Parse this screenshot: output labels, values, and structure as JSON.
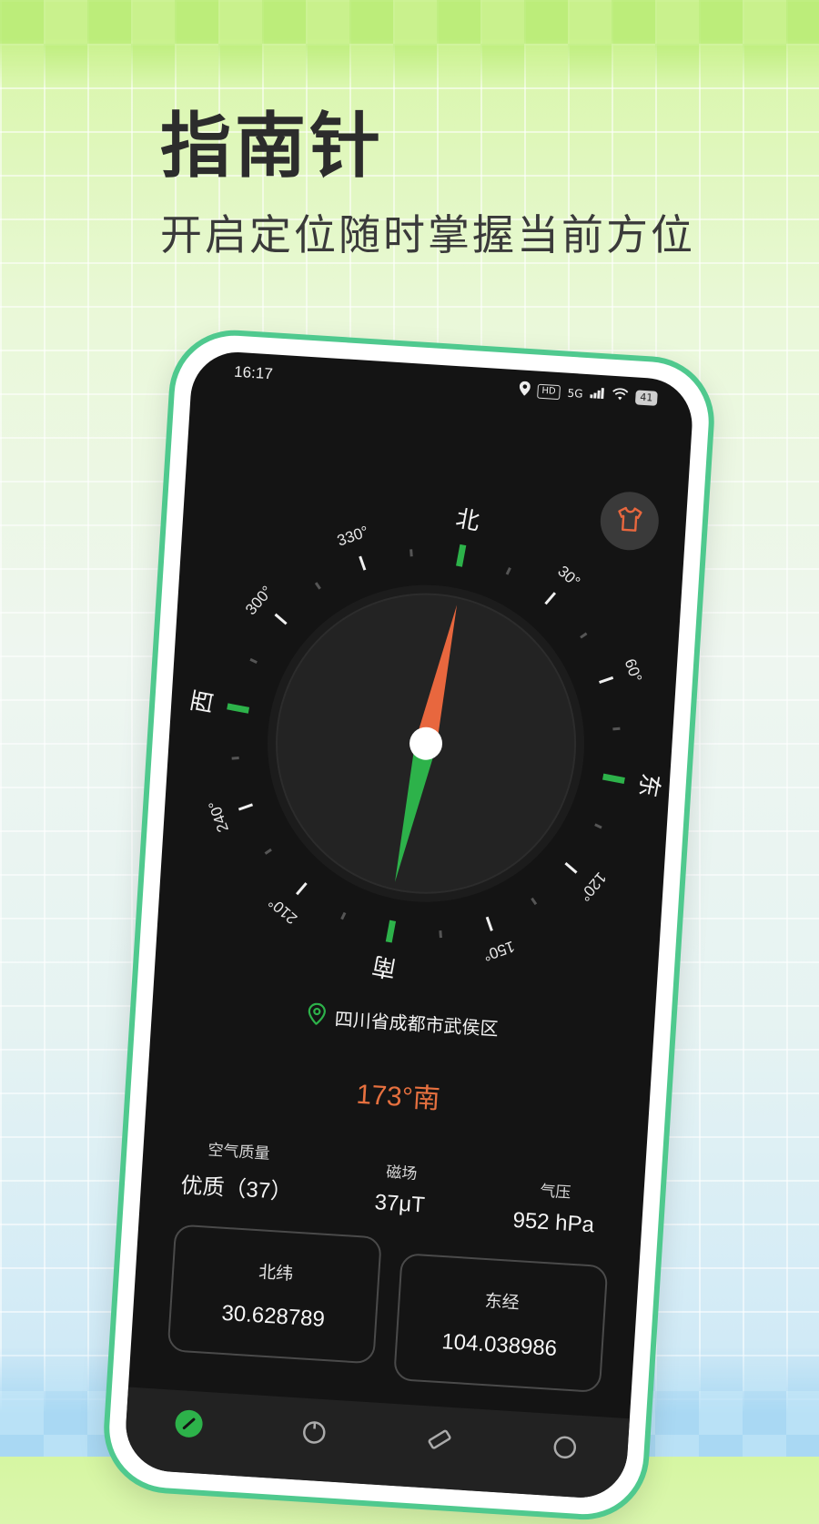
{
  "hero": {
    "title": "指南针",
    "subtitle": "开启定位随时掌握当前方位"
  },
  "status_bar": {
    "time": "16:17",
    "hd_label": "HD",
    "network_label": "5G",
    "battery": "41"
  },
  "compass": {
    "heading_degrees": 173,
    "cardinals": {
      "north": "北",
      "east": "东",
      "south": "南",
      "west": "西"
    },
    "degree_labels": [
      "30°",
      "60°",
      "120°",
      "150°",
      "210°",
      "240°",
      "300°",
      "330°"
    ],
    "needle_colors": {
      "north_tip": "#2db24a",
      "south_tip": "#e8673e"
    },
    "cardinal_tick_color": "#2db24a"
  },
  "location": {
    "text": "四川省成都市武侯区"
  },
  "heading_text": "173°南",
  "stats": {
    "air_quality": {
      "label": "空气质量",
      "value": "优质（37）"
    },
    "magnetic": {
      "label": "磁场",
      "value": "37μT"
    },
    "pressure": {
      "label": "气压",
      "value": "952 hPa"
    }
  },
  "coordinates": {
    "latitude": {
      "label": "北纬",
      "value": "30.628789"
    },
    "longitude": {
      "label": "东经",
      "value": "104.038986"
    }
  },
  "bottom_nav": {
    "items": [
      "compass-icon",
      "level-icon",
      "ruler-icon",
      "more-icon"
    ]
  },
  "colors": {
    "accent_green": "#2db24a",
    "accent_orange": "#e6703f",
    "phone_frame": "#4fc98e"
  }
}
